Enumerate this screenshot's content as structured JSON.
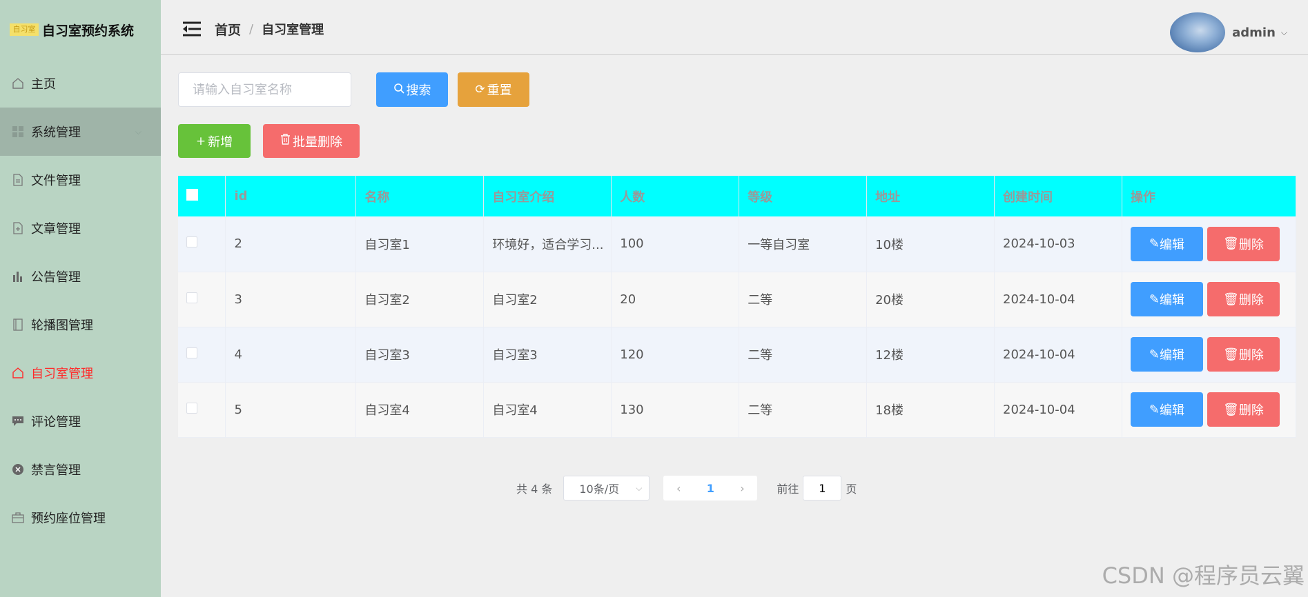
{
  "app": {
    "logo_text": "自习室",
    "title": "自习室预约系统"
  },
  "sidebar": {
    "items": [
      {
        "label": "主页",
        "icon": "home-icon"
      },
      {
        "label": "系统管理",
        "icon": "grid-icon"
      },
      {
        "label": "文件管理",
        "icon": "document-icon"
      },
      {
        "label": "文章管理",
        "icon": "document-add-icon"
      },
      {
        "label": "公告管理",
        "icon": "chart-icon"
      },
      {
        "label": "轮播图管理",
        "icon": "notebook-icon"
      },
      {
        "label": "自习室管理",
        "icon": "home-icon"
      },
      {
        "label": "评论管理",
        "icon": "chat-icon"
      },
      {
        "label": "禁言管理",
        "icon": "circle-close-icon"
      },
      {
        "label": "预约座位管理",
        "icon": "briefcase-icon"
      }
    ],
    "active_group": "系统管理",
    "current": "自习室管理",
    "current_color": "#ff2a2a"
  },
  "header": {
    "breadcrumb_home": "首页",
    "breadcrumb_sep": "/",
    "breadcrumb_current": "自习室管理",
    "username": "admin"
  },
  "search": {
    "placeholder": "请输入自习室名称",
    "search_label": "搜索",
    "reset_label": "重置"
  },
  "toolbar": {
    "add_label": "新增",
    "batch_delete_label": "批量删除"
  },
  "table": {
    "header_bg": "#00ffff",
    "columns": [
      "id",
      "名称",
      "自习室介绍",
      "人数",
      "等级",
      "地址",
      "创建时间",
      "操作"
    ],
    "rows": [
      {
        "id": "2",
        "name": "自习室1",
        "intro": "环境好，适合学习...",
        "count": "100",
        "level": "一等自习室",
        "address": "10楼",
        "created": "2024-10-03"
      },
      {
        "id": "3",
        "name": "自习室2",
        "intro": "自习室2",
        "count": "20",
        "level": "二等",
        "address": "20楼",
        "created": "2024-10-04"
      },
      {
        "id": "4",
        "name": "自习室3",
        "intro": "自习室3",
        "count": "120",
        "level": "二等",
        "address": "12楼",
        "created": "2024-10-04"
      },
      {
        "id": "5",
        "name": "自习室4",
        "intro": "自习室4",
        "count": "130",
        "level": "二等",
        "address": "18楼",
        "created": "2024-10-04"
      }
    ],
    "edit_label": "编辑",
    "delete_label": "删除"
  },
  "pagination": {
    "total_text": "共 4 条",
    "page_size": "10条/页",
    "current_page": "1",
    "goto_label": "前往",
    "goto_value": "1",
    "page_suffix": "页"
  },
  "watermark": "CSDN @程序员云翼",
  "colors": {
    "primary": "#409eff",
    "success": "#67c23a",
    "warning": "#e6a23c",
    "danger": "#f56c6c",
    "sidebar_bg": "#b9d4c3"
  }
}
